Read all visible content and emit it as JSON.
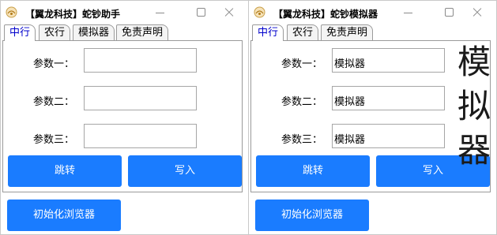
{
  "left": {
    "title": "【翼龙科技】蛇钞助手",
    "tabs": [
      "中行",
      "农行",
      "模拟器",
      "免责声明"
    ],
    "fields": [
      {
        "label": "参数一：",
        "value": ""
      },
      {
        "label": "参数二：",
        "value": ""
      },
      {
        "label": "参数三：",
        "value": ""
      }
    ],
    "buttons": {
      "jump": "跳转",
      "write": "写入",
      "init": "初始化浏览器"
    }
  },
  "right": {
    "title": "【翼龙科技】蛇钞模拟器",
    "tabs": [
      "中行",
      "农行",
      "免责声明"
    ],
    "fields": [
      {
        "label": "参数一：",
        "value": "模拟器"
      },
      {
        "label": "参数二：",
        "value": "模拟器"
      },
      {
        "label": "参数三：",
        "value": "模拟器"
      }
    ],
    "big_chars": [
      "模",
      "拟",
      "器"
    ],
    "buttons": {
      "jump": "跳转",
      "write": "写入",
      "init": "初始化浏览器"
    }
  },
  "colors": {
    "accent": "#1a7cff",
    "active_tab_text": "#0000cc"
  }
}
